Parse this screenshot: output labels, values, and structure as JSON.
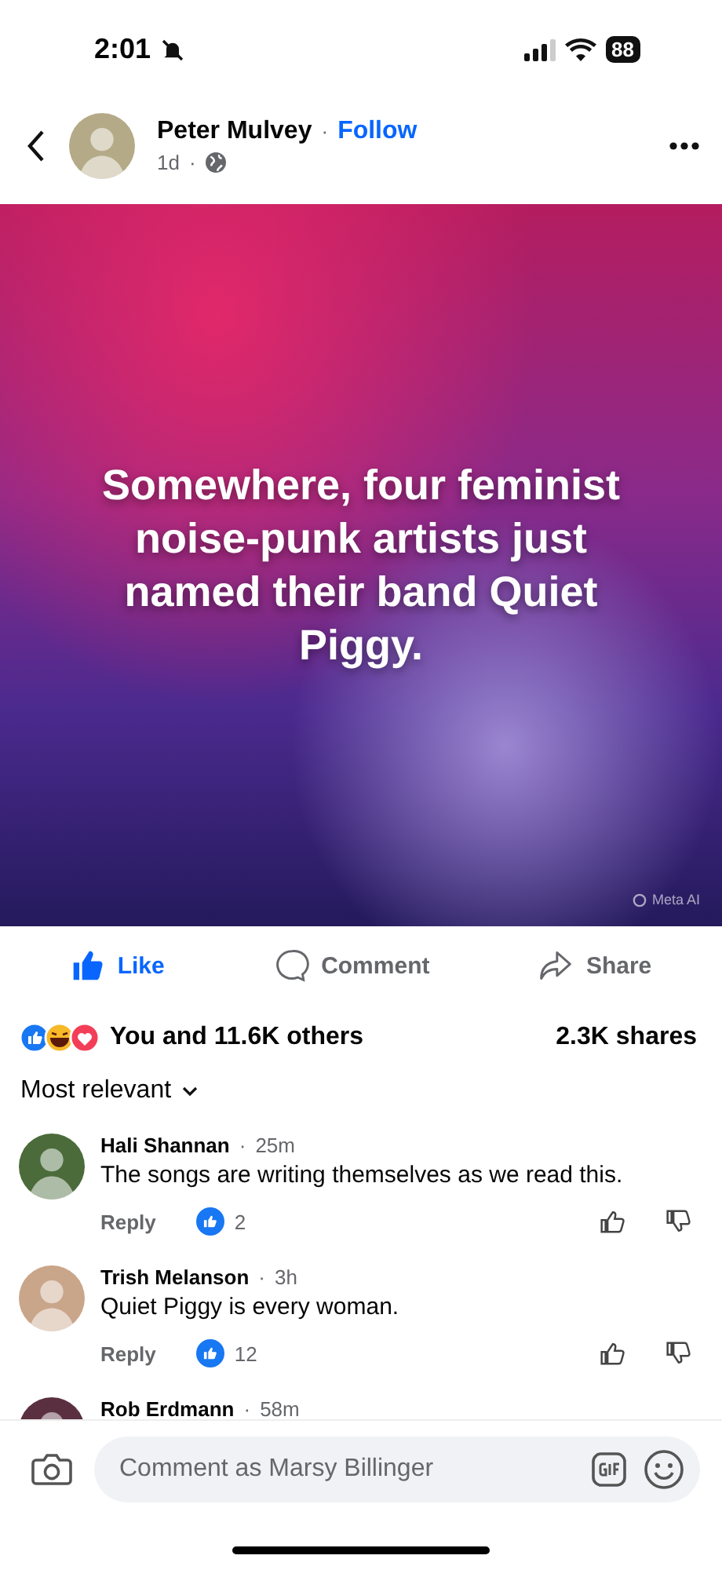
{
  "separator": "·",
  "status_bar": {
    "time": "2:01",
    "battery": "88",
    "muted": true
  },
  "post": {
    "author": "Peter Mulvey",
    "follow": "Follow",
    "age": "1d",
    "card_text": "Somewhere, four feminist noise-punk artists just named their band Quiet Piggy.",
    "watermark_label": "Meta AI",
    "actions": [
      {
        "kind": "like",
        "label": "Like",
        "selected": true
      },
      {
        "kind": "comment",
        "label": "Comment",
        "selected": false
      },
      {
        "kind": "share",
        "label": "Share",
        "selected": false
      }
    ],
    "reactions_text": "You and 11.6K others",
    "shares": "2.3K shares"
  },
  "sort": {
    "label": "Most relevant"
  },
  "comments": [
    {
      "name": "Hali Shannan",
      "time": "25m",
      "text": "The songs are writing themselves as we read this.",
      "reply": "Reply",
      "likes": "2"
    },
    {
      "name": "Trish Melanson",
      "time": "3h",
      "text": "Quiet Piggy is every woman.",
      "reply": "Reply",
      "likes": "12"
    },
    {
      "name": "Rob Erdmann",
      "time": "58m"
    }
  ],
  "composer": {
    "placeholder": "Comment as Marsy Billinger"
  }
}
